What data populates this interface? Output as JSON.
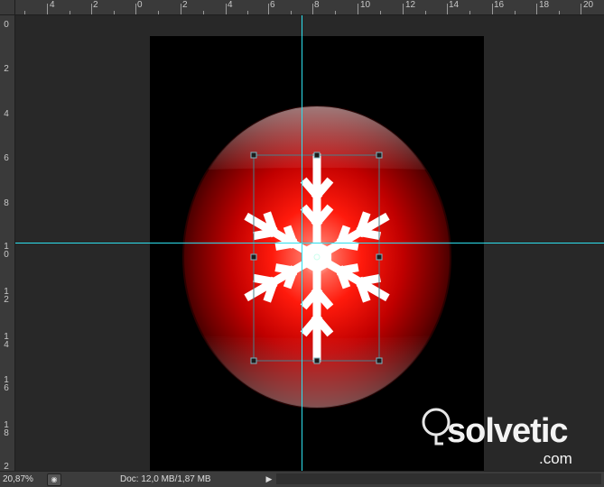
{
  "ruler_top": [
    "4",
    "2",
    "0",
    "2",
    "4",
    "6",
    "8",
    "10",
    "12",
    "14",
    "16",
    "18",
    "20"
  ],
  "ruler_left": [
    "0",
    "2",
    "4",
    "6",
    "8",
    "1\n0",
    "1\n2",
    "1\n4",
    "1\n6",
    "1\n8",
    "2"
  ],
  "status": {
    "zoom": "20,87%",
    "doc": "Doc: 12,0 MB/1,87 MB"
  },
  "watermark": {
    "brand": "solvetic",
    "domain": ".com"
  },
  "icons": {
    "snowflake": "snowflake-icon",
    "navigator": "navigator-icon",
    "menu_arrow": "triangle-right-icon"
  },
  "colors": {
    "canvas": "#000000",
    "ornament": "#c40000",
    "guide": "#2de0ee",
    "ui_dark": "#282828"
  }
}
